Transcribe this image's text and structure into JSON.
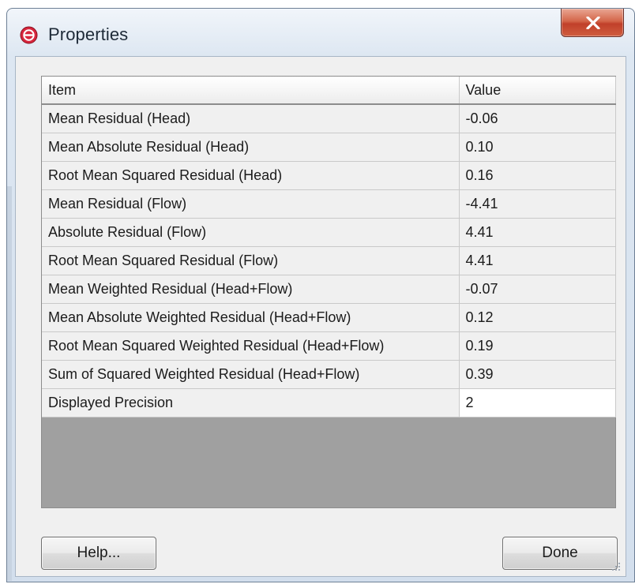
{
  "window": {
    "title": "Properties",
    "icon": "app-icon",
    "close_glyph": "x"
  },
  "grid": {
    "columns": [
      "Item",
      "Value"
    ],
    "rows": [
      {
        "item": "Mean Residual (Head)",
        "value": "-0.06"
      },
      {
        "item": "Mean Absolute Residual (Head)",
        "value": "0.10"
      },
      {
        "item": "Root Mean Squared Residual (Head)",
        "value": "0.16"
      },
      {
        "item": "Mean Residual (Flow)",
        "value": "-4.41"
      },
      {
        "item": "Absolute Residual (Flow)",
        "value": "4.41"
      },
      {
        "item": "Root Mean Squared Residual (Flow)",
        "value": "4.41"
      },
      {
        "item": "Mean Weighted Residual (Head+Flow)",
        "value": "-0.07"
      },
      {
        "item": "Mean Absolute Weighted Residual (Head+Flow)",
        "value": "0.12"
      },
      {
        "item": "Root Mean Squared Weighted Residual (Head+Flow)",
        "value": "0.19"
      },
      {
        "item": "Sum of Squared Weighted Residual (Head+Flow)",
        "value": "0.39"
      },
      {
        "item": "Displayed Precision",
        "value": "2"
      }
    ]
  },
  "buttons": {
    "help_label": "Help...",
    "done_label": "Done"
  },
  "colors": {
    "title_bar": "#dde7f2",
    "close_button": "#c94a30",
    "grid_empty_area": "#a0a0a0",
    "dialog_background": "#f0f0f0"
  }
}
